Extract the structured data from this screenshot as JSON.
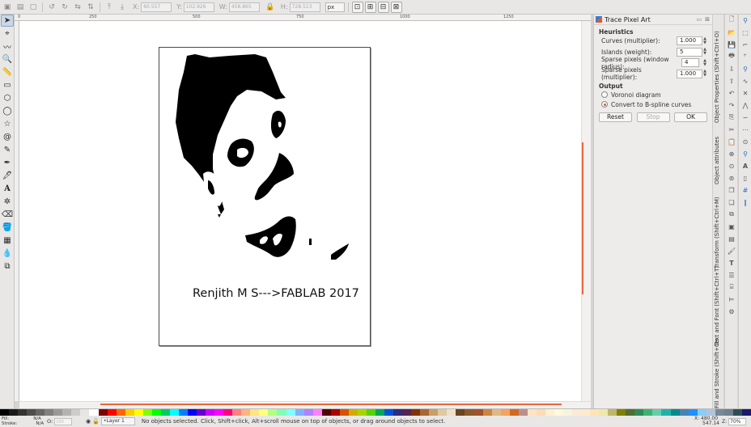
{
  "toolbar": {
    "x_label": "X:",
    "x_value": "60.557",
    "y_label": "Y:",
    "y_value": "102.926",
    "w_label": "W:",
    "w_value": "458.865",
    "h_label": "H:",
    "h_value": "728.513",
    "unit": "px"
  },
  "ruler": {
    "top_labels": [
      "0",
      "250",
      "500",
      "750",
      "1000",
      "1250"
    ]
  },
  "canvas": {
    "page_text": "Renjith M S--->FABLAB 2017"
  },
  "dock": {
    "title": "Trace Pixel Art",
    "heuristics_label": "Heuristics",
    "params": [
      {
        "label": "Curves (multiplier):",
        "value": "1.000"
      },
      {
        "label": "Islands (weight):",
        "value": "5"
      },
      {
        "label": "Sparse pixels (window radius):",
        "value": "4"
      },
      {
        "label": "Sparse pixels (multiplier):",
        "value": "1.000"
      }
    ],
    "output_label": "Output",
    "radio_voronoi": "Voronoi diagram",
    "radio_bspline": "Convert to B-spline curves",
    "reset_label": "Reset",
    "stop_label": "Stop",
    "ok_label": "OK"
  },
  "tabs": {
    "object_properties": "Object Properties (Shift+Ctrl+O)",
    "object_attributes": "Object attributes",
    "transform": "Transform (Shift+Ctrl+M)",
    "text_font": "Text and Font (Shift+Ctrl+T)",
    "fill_stroke": "Fill and Stroke (Shift+Ctrl+F)"
  },
  "status": {
    "fill_label": "Fill:",
    "fill_value": "N/A",
    "stroke_label": "Stroke:",
    "stroke_value": "N/A",
    "opacity_label": "O:",
    "opacity_value": "100",
    "layer": "•Layer 1",
    "message": "No objects selected. Click, Shift+click, Alt+scroll mouse on top of objects, or drag around objects to select.",
    "x_coord": "X: 480.00",
    "y_coord": "547.14",
    "zoom_label": "Z:",
    "zoom_value": "70%"
  },
  "palette": [
    "#000000",
    "#1a1a1a",
    "#333333",
    "#4d4d4d",
    "#666666",
    "#808080",
    "#999999",
    "#b3b3b3",
    "#cccccc",
    "#e6e6e6",
    "#ffffff",
    "#800000",
    "#ff0000",
    "#ff6600",
    "#ffcc00",
    "#ffff00",
    "#80ff00",
    "#00ff00",
    "#00cc66",
    "#00ffff",
    "#0080ff",
    "#0000ff",
    "#6600cc",
    "#cc00ff",
    "#ff00ff",
    "#ff0080",
    "#ff8080",
    "#ffb380",
    "#ffe680",
    "#ffff80",
    "#b3ff80",
    "#80ffb3",
    "#80ffff",
    "#80b3ff",
    "#b380ff",
    "#ff80ff",
    "#550000",
    "#aa0000",
    "#d45500",
    "#d4aa00",
    "#aad400",
    "#55d400",
    "#00aa55",
    "#0055d4",
    "#2c2c80",
    "#552255",
    "#803300",
    "#aa6633",
    "#c8a064",
    "#e0c8a0",
    "#f0e0c8",
    "#6b4423",
    "#8b5a2b",
    "#a0522d",
    "#cd853f",
    "#deb887",
    "#f4a460",
    "#d2691e",
    "#bc8f8f",
    "#ffe4c4",
    "#ffdab9",
    "#ffefd5",
    "#fff8dc",
    "#f5f5dc",
    "#faebd7",
    "#ffebcd",
    "#ffe4b5",
    "#eee8aa",
    "#bdb76b",
    "#808000",
    "#556b2f",
    "#2e8b57",
    "#3cb371",
    "#66cdaa",
    "#20b2aa",
    "#008b8b",
    "#4682b4",
    "#1e90ff",
    "#87cefa",
    "#b0c4de",
    "#778899",
    "#708090",
    "#2f4f4f",
    "#191970"
  ]
}
